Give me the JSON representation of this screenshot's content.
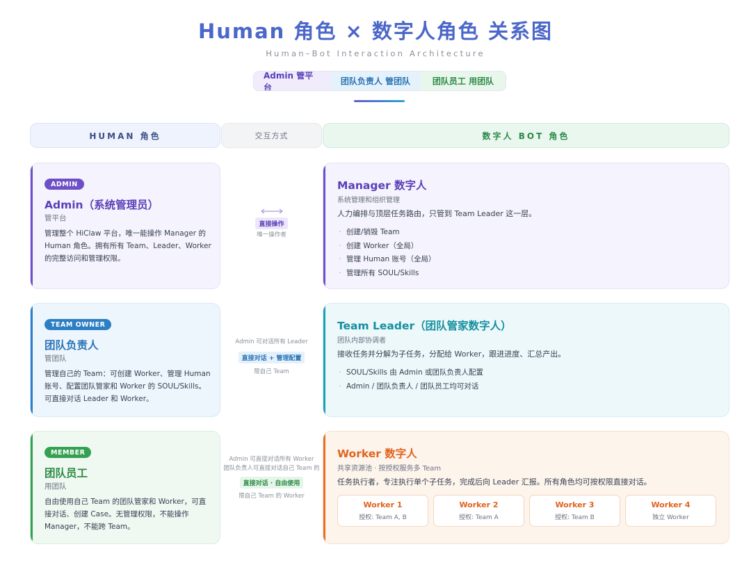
{
  "header": {
    "title": "Human 角色 × 数字人角色 关系图",
    "subtitle": "Human–Bot Interaction Architecture",
    "pills": [
      "Admin 管平台",
      "团队负责人 管团队",
      "团队员工 用团队"
    ]
  },
  "columns": {
    "human": "HUMAN 角色",
    "interaction": "交互方式",
    "bot": "数字人 BOT 角色"
  },
  "humans": [
    {
      "badge": "ADMIN",
      "name": "Admin（系统管理员）",
      "sub": "管平台",
      "desc": "管理整个 HiClaw 平台，唯一能操作 Manager 的 Human 角色。拥有所有 Team、Leader、Worker 的完整访问和管理权限。",
      "color": "#6d4fc7"
    },
    {
      "badge": "TEAM OWNER",
      "name": "团队负责人",
      "sub": "管团队",
      "desc": "管理自己的 Team：可创建 Worker、管理 Human 账号、配置团队管家和 Worker 的 SOUL/Skills。可直接对话 Leader 和 Worker。",
      "color": "#2c7fc4"
    },
    {
      "badge": "MEMBER",
      "name": "团队员工",
      "sub": "用团队",
      "desc": "自由使用自己 Team 的团队管家和 Worker，可直接对话、创建 Case。无管理权限，不能操作 Manager，不能跨 Team。",
      "color": "#34a052"
    }
  ],
  "interactions": [
    {
      "top": "",
      "tag": "直接操作",
      "bottom": "唯一操作者"
    },
    {
      "top": "Admin 可对话所有 Leader",
      "tag": "直接对话 + 管理配置",
      "bottom": "限自己 Team"
    },
    {
      "top": "Admin 可直接对话所有 Worker\n团队负责人可直接对话自己 Team 的",
      "tag": "直接对话 · 自由使用",
      "bottom": "限自己 Team 的 Worker"
    }
  ],
  "bots": {
    "manager": {
      "name": "Manager 数字人",
      "sub": "系统管理和组织管理",
      "desc": "人力编排与顶层任务路由，只管到 Team Leader 这一层。",
      "items": [
        "创建/销毁 Team",
        "创建 Worker（全局）",
        "管理 Human 账号（全局）",
        "管理所有 SOUL/Skills"
      ],
      "color": "#6d4fc7"
    },
    "leader": {
      "name": "Team Leader（团队管家数字人）",
      "sub": "团队内部协调者",
      "desc": "接收任务并分解为子任务，分配给 Worker，跟进进度、汇总产出。",
      "items": [
        "SOUL/Skills 由 Admin 或团队负责人配置",
        "Admin / 团队负责人 / 团队员工均可对话"
      ],
      "color": "#1aa3b5"
    },
    "worker": {
      "name": "Worker 数字人",
      "sub": "共享资源池 · 按授权服务多 Team",
      "desc": "任务执行者，专注执行单个子任务，完成后向 Leader 汇报。所有角色均可按权限直接对话。",
      "workers": [
        {
          "name": "Worker 1",
          "perm": "授权: Team A, B"
        },
        {
          "name": "Worker 2",
          "perm": "授权: Team A"
        },
        {
          "name": "Worker 3",
          "perm": "授权: Team B"
        },
        {
          "name": "Worker 4",
          "perm": "独立 Worker"
        }
      ],
      "color": "#ea6d28"
    }
  }
}
